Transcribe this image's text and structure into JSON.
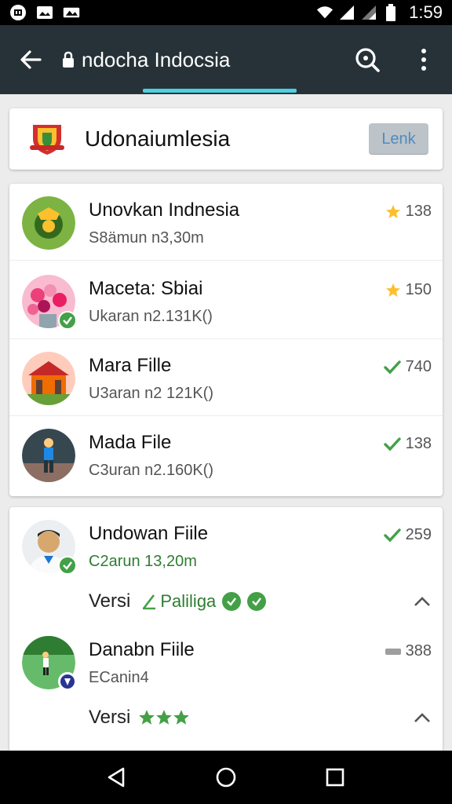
{
  "status_bar": {
    "time": "1:59",
    "icons": [
      "sim-card-icon",
      "image-icon",
      "gallery-icon",
      "wifi-icon",
      "signal-icon",
      "signal-icon",
      "battery-icon"
    ]
  },
  "app_bar": {
    "url": "ndocha Indocsia",
    "icons": [
      "back-arrow-icon",
      "lock-icon",
      "search-icon",
      "more-vert-icon"
    ],
    "color": "#263238",
    "indicator_color": "#4dd0e1"
  },
  "header": {
    "title": "Udonaiumlesia",
    "button_label": "Lenk"
  },
  "list": [
    {
      "title": "Unovkan Indnesia",
      "subtitle": "S8ämun n3,30m",
      "meta": "138",
      "meta_icon": "star-icon",
      "badge": "none"
    },
    {
      "title": "Maceta: Sbiai",
      "subtitle": "Ukaran n2.131K()",
      "meta": "150",
      "meta_icon": "star-icon",
      "badge": "check"
    },
    {
      "title": "Mara Fille",
      "subtitle": "U3aran n2 121K()",
      "meta": "740",
      "meta_icon": "check-icon",
      "badge": "none"
    },
    {
      "title": "Mada File",
      "subtitle": "C3uran n2.160K()",
      "meta": "138",
      "meta_icon": "check-icon",
      "badge": "none"
    }
  ],
  "list2": [
    {
      "title": "Undowan Fiile",
      "subtitle": "C2arun 13,20m",
      "meta": "259",
      "meta_icon": "check-icon",
      "badge": "check",
      "versi_label": "Versi",
      "versi_link": "Paliliga"
    },
    {
      "title": "Danabn Fiile",
      "subtitle": "ECanin4",
      "meta": "388",
      "meta_icon": "bar-icon",
      "badge": "blue",
      "versi_label": "Versi",
      "stars": 3
    }
  ],
  "colors": {
    "accent_green": "#43a047",
    "star": "#fbc02d",
    "button_bg": "#bcc3c9"
  }
}
